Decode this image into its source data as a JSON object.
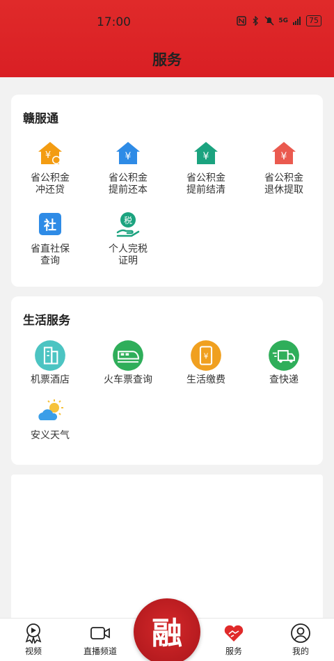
{
  "status": {
    "time": "17:00",
    "battery": "75",
    "network": "5G"
  },
  "header": {
    "title": "服务"
  },
  "gan_card": {
    "title": "赣服通",
    "items": [
      {
        "label": "省公积金\n冲还贷",
        "icon": "house-loan-icon",
        "color": "#f39c12"
      },
      {
        "label": "省公积金\n提前还本",
        "icon": "house-yen-icon",
        "color": "#2e8be6"
      },
      {
        "label": "省公积金\n提前结清",
        "icon": "house-yen-icon",
        "color": "#1ba37f"
      },
      {
        "label": "省公积金\n退休提取",
        "icon": "house-yen-icon",
        "color": "#ea5a4f"
      },
      {
        "label": "省直社保\n查询",
        "icon": "social-security-icon",
        "color": "#2e8be6",
        "glyph": "社"
      },
      {
        "label": "个人完税\n证明",
        "icon": "tax-certificate-icon",
        "color": "#1ba37f",
        "glyph": "税"
      }
    ]
  },
  "life_card": {
    "title": "生活服务",
    "items": [
      {
        "label": "机票酒店",
        "icon": "hotel-building-icon",
        "color": "#4cc4c2"
      },
      {
        "label": "火车票查询",
        "icon": "train-icon",
        "color": "#2fae5a"
      },
      {
        "label": "生活缴费",
        "icon": "bill-payment-icon",
        "color": "#f0a020"
      },
      {
        "label": "查快递",
        "icon": "delivery-truck-icon",
        "color": "#2fae5a"
      },
      {
        "label": "安义天气",
        "icon": "weather-icon",
        "color": "#3a9ee8"
      }
    ]
  },
  "nav": {
    "items": [
      {
        "label": "视频",
        "icon": "video-badge-icon"
      },
      {
        "label": "直播频道",
        "icon": "camera-icon"
      },
      {
        "label": "服务",
        "icon": "handshake-heart-icon",
        "color": "#e02a2a"
      },
      {
        "label": "我的",
        "icon": "user-icon"
      }
    ],
    "center_glyph": "融",
    "center_color": "#c41f23"
  }
}
